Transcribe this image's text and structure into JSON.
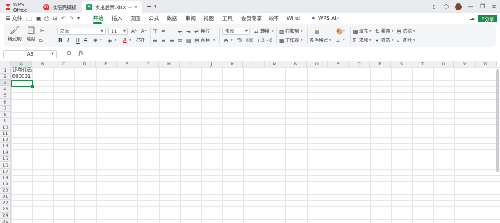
{
  "tabs": [
    {
      "label": "WPS Office",
      "icon": "wps-logo-icon"
    },
    {
      "label": "找稻壳模板",
      "icon": "template-icon"
    },
    {
      "label": "卖出股票.xlsx",
      "icon": "spreadsheet-icon"
    }
  ],
  "menu": {
    "file": "文件",
    "items": [
      "开始",
      "插入",
      "页面",
      "公式",
      "数据",
      "审阅",
      "视图",
      "工具",
      "会员专享",
      "效率",
      "Wind"
    ],
    "active": "开始",
    "ai": "WPS AI",
    "share": "分享"
  },
  "ribbon": {
    "format_painter": "格式刷",
    "paste": "粘贴",
    "font_name": "宋体",
    "font_size": "11",
    "bold": "B",
    "italic": "I",
    "underline": "U",
    "strikethrough": "S",
    "font_color": "A",
    "wrap": "换行",
    "merge": "合并",
    "number_format": "常规",
    "convert": "转换",
    "row_col": "行和列",
    "worksheet": "工作表",
    "cond_format": "条件格式",
    "fill": "填充",
    "sort": "排序",
    "freeze": "冻结",
    "sum": "求和",
    "filter": "筛选",
    "find": "查找",
    "percent": "%",
    "thousand": "000"
  },
  "formula_bar": {
    "name_box": "A3",
    "fx": "fx",
    "formula": ""
  },
  "grid": {
    "columns": [
      "A",
      "B",
      "C",
      "D",
      "E",
      "F",
      "G",
      "H",
      "I",
      "J",
      "K",
      "L",
      "M",
      "N",
      "O",
      "P",
      "Q",
      "R",
      "S",
      "T",
      "U",
      "V",
      "W"
    ],
    "rows": [
      "1",
      "2",
      "3",
      "4",
      "5",
      "6",
      "7",
      "8",
      "9",
      "10",
      "11",
      "12",
      "13",
      "14",
      "15",
      "16",
      "17",
      "18",
      "19",
      "20",
      "21",
      "22",
      "23",
      "24",
      "25"
    ],
    "cells": {
      "A1": "证券代码",
      "A2": "600031"
    },
    "selected_cell": "A3"
  },
  "colors": {
    "accent": "#1e8b4a",
    "wps_red": "#e0302c",
    "sheet_green": "#1aa260"
  }
}
